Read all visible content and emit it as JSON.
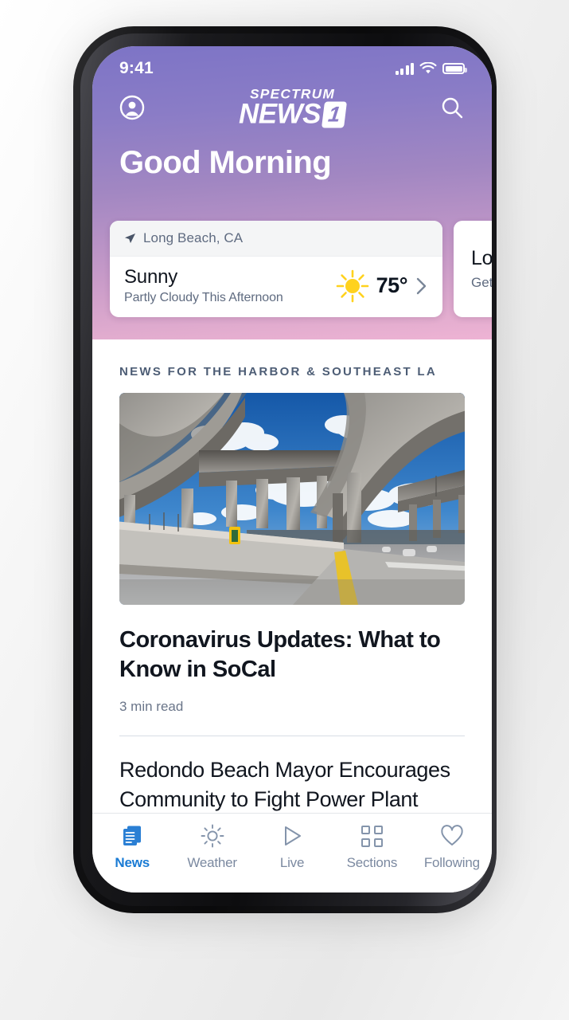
{
  "status_bar": {
    "time": "9:41",
    "signal_icon": "cellular-bars-icon",
    "wifi_icon": "wifi-icon",
    "battery_icon": "battery-full-icon"
  },
  "header": {
    "profile_icon": "profile-avatar-icon",
    "search_icon": "search-icon",
    "logo_top": "SPECTRUM",
    "logo_main": "NEWS",
    "logo_badge": "1",
    "greeting": "Good Morning",
    "gradient_top": "#7d74c6",
    "gradient_bottom": "#eeb3d4"
  },
  "weather_card": {
    "location_icon": "location-arrow-icon",
    "location": "Long Beach, CA",
    "condition": "Sunny",
    "forecast": "Partly Cloudy This Afternoon",
    "temperature": "75°",
    "weather_icon": "sun-icon",
    "sun_color": "#FFD21E",
    "chevron_icon": "chevron-right-icon"
  },
  "secondary_card": {
    "title": "Loca",
    "subtitle": "Get th"
  },
  "feed": {
    "section_header": "NEWS FOR THE HARBOR & SOUTHEAST LA",
    "lead_article": {
      "image_alt": "freeway-interchange-photo",
      "title": "Coronavirus Updates: What to Know in SoCal",
      "read_time": "3 min read"
    },
    "second_article": {
      "title": "Redondo Beach Mayor Encourages Community to Fight Power Plant Extension"
    }
  },
  "tabbar": {
    "active_color": "#1a7bd4",
    "inactive_color": "#7b89a0",
    "items": [
      {
        "label": "News",
        "icon": "news-documents-icon",
        "active": true
      },
      {
        "label": "Weather",
        "icon": "sun-outline-icon",
        "active": false
      },
      {
        "label": "Live",
        "icon": "play-triangle-icon",
        "active": false
      },
      {
        "label": "Sections",
        "icon": "grid-squares-icon",
        "active": false
      },
      {
        "label": "Following",
        "icon": "heart-outline-icon",
        "active": false
      }
    ]
  }
}
